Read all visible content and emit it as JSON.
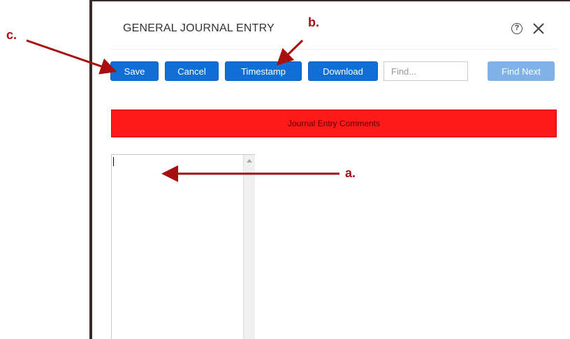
{
  "dialog": {
    "title": "GENERAL JOURNAL ENTRY",
    "help_glyph": "?",
    "help_icon": "help-circle-icon",
    "close_icon": "close-x-icon"
  },
  "toolbar": {
    "save_label": "Save",
    "cancel_label": "Cancel",
    "timestamp_label": "Timestamp",
    "download_label": "Download",
    "find_placeholder": "Find...",
    "find_value": "",
    "find_next_label": "Find Next"
  },
  "comments": {
    "header_label": "Journal Entry Comments",
    "text": ""
  },
  "annotations": {
    "a": "a.",
    "b": "b.",
    "c": "c."
  },
  "colors": {
    "primary_button": "#0f6fd6",
    "disabled_button": "#7fb2e8",
    "comments_bar": "#ff1a1a",
    "annotation": "#a80f0f"
  }
}
